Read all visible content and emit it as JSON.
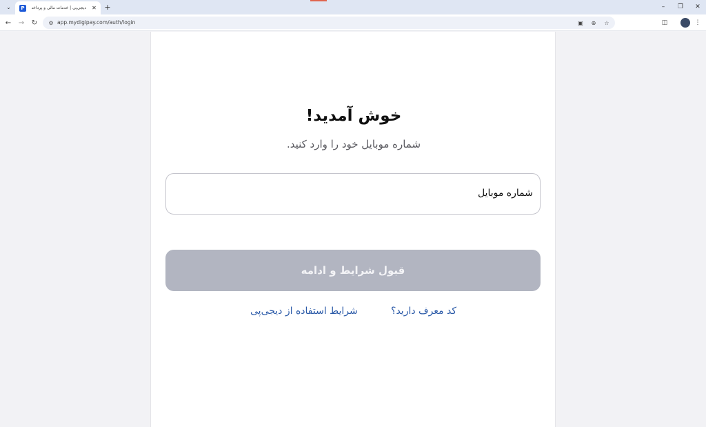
{
  "browser": {
    "tab_title": "دیجی‌پی | خدمات مالی و پرداخت",
    "favicon_letter": "P",
    "url": "app.mydigipay.com/auth/login",
    "colors": {
      "tabstrip": "#dfe6f3",
      "favicon": "#1e5ad8"
    }
  },
  "login": {
    "title": "خوش آمدید!",
    "subtitle": "شماره موبایل خود را وارد کنید.",
    "phone_label": "شماره موبایل",
    "submit_label": "قبول شرایط و ادامه",
    "referral_link": "کد معرف دارید؟",
    "terms_link": "شرایط استفاده از دیجی‌پی"
  },
  "colors": {
    "page_bg": "#f2f2f5",
    "card_bg": "#ffffff",
    "button_disabled": "#b2b5c1",
    "link": "#2b5aa8"
  }
}
